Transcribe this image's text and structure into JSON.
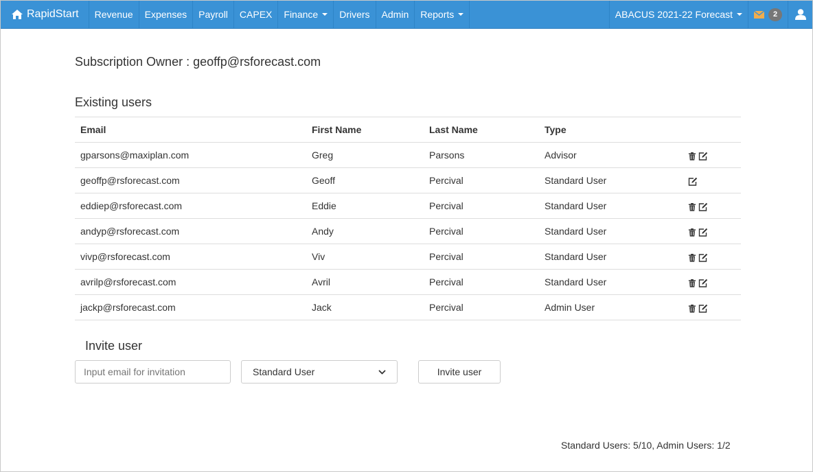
{
  "navbar": {
    "brand": "RapidStart",
    "items": [
      {
        "label": "Revenue"
      },
      {
        "label": "Expenses"
      },
      {
        "label": "Payroll"
      },
      {
        "label": "CAPEX"
      },
      {
        "label": "Finance",
        "dropdown": true
      },
      {
        "label": "Drivers"
      },
      {
        "label": "Admin"
      },
      {
        "label": "Reports",
        "dropdown": true
      }
    ],
    "forecast": "ABACUS 2021-22 Forecast",
    "messages_count": "2"
  },
  "owner": "Subscription Owner : geoffp@rsforecast.com",
  "existing_title": "Existing users",
  "table": {
    "headers": {
      "email": "Email",
      "first": "First Name",
      "last": "Last Name",
      "type": "Type"
    },
    "rows": [
      {
        "email": "gparsons@maxiplan.com",
        "first": "Greg",
        "last": "Parsons",
        "type": "Advisor",
        "deletable": true
      },
      {
        "email": "geoffp@rsforecast.com",
        "first": "Geoff",
        "last": "Percival",
        "type": "Standard User",
        "deletable": false
      },
      {
        "email": "eddiep@rsforecast.com",
        "first": "Eddie",
        "last": "Percival",
        "type": "Standard User",
        "deletable": true
      },
      {
        "email": "andyp@rsforecast.com",
        "first": "Andy",
        "last": "Percival",
        "type": "Standard User",
        "deletable": true
      },
      {
        "email": "vivp@rsforecast.com",
        "first": "Viv",
        "last": "Percival",
        "type": "Standard User",
        "deletable": true
      },
      {
        "email": "avrilp@rsforecast.com",
        "first": "Avril",
        "last": "Percival",
        "type": "Standard User",
        "deletable": true
      },
      {
        "email": "jackp@rsforecast.com",
        "first": "Jack",
        "last": "Percival",
        "type": "Admin User",
        "deletable": true
      }
    ]
  },
  "invite": {
    "title": "Invite user",
    "placeholder": "Input email for invitation",
    "selected_type": "Standard User",
    "button": "Invite user"
  },
  "counts": "Standard Users: 5/10, Admin Users: 1/2",
  "colors": {
    "navbar": "#3a92d6",
    "envelope": "#f0ad4e",
    "badge": "#777777"
  }
}
